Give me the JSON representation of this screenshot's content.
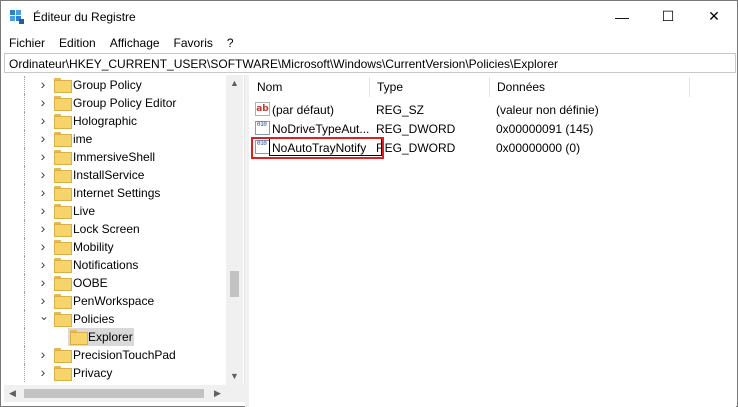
{
  "window": {
    "title": "Éditeur du Registre",
    "controls": {
      "minimize": "—",
      "maximize": "☐",
      "close": "✕"
    }
  },
  "menu": [
    "Fichier",
    "Edition",
    "Affichage",
    "Favoris",
    "?"
  ],
  "address": {
    "path": "Ordinateur\\HKEY_CURRENT_USER\\SOFTWARE\\Microsoft\\Windows\\CurrentVersion\\Policies\\Explorer"
  },
  "tree": {
    "items": [
      {
        "label": "Group Policy",
        "expanded": false
      },
      {
        "label": "Group Policy Editor",
        "expanded": false
      },
      {
        "label": "Holographic",
        "expanded": false
      },
      {
        "label": "ime",
        "expanded": false
      },
      {
        "label": "ImmersiveShell",
        "expanded": false
      },
      {
        "label": "InstallService",
        "expanded": false
      },
      {
        "label": "Internet Settings",
        "expanded": false
      },
      {
        "label": "Live",
        "expanded": false
      },
      {
        "label": "Lock Screen",
        "expanded": false
      },
      {
        "label": "Mobility",
        "expanded": false
      },
      {
        "label": "Notifications",
        "expanded": false
      },
      {
        "label": "OOBE",
        "expanded": false
      },
      {
        "label": "PenWorkspace",
        "expanded": false
      },
      {
        "label": "Policies",
        "expanded": true
      },
      {
        "label": "Explorer",
        "selected": true
      },
      {
        "label": "PrecisionTouchPad",
        "expanded": false
      },
      {
        "label": "Privacy",
        "expanded": false
      }
    ]
  },
  "list": {
    "columns": [
      "Nom",
      "Type",
      "Données"
    ],
    "rows": [
      {
        "icon": "string-value-icon",
        "icon_text": "ab",
        "name": "(par défaut)",
        "type": "REG_SZ",
        "data": "(valeur non définie)"
      },
      {
        "icon": "binary-value-icon",
        "icon_text": "010",
        "name": "NoDriveTypeAut...",
        "type": "REG_DWORD",
        "data": "0x00000091 (145)"
      },
      {
        "icon": "binary-value-icon",
        "icon_text": "010",
        "name": "NoAutoTrayNotify",
        "type": "REG_DWORD",
        "data": "0x00000000 (0)",
        "editing": true
      }
    ]
  },
  "colors": {
    "highlight": "#e02020",
    "selection": "#d9d9d9",
    "folder": "#f7d46b"
  }
}
